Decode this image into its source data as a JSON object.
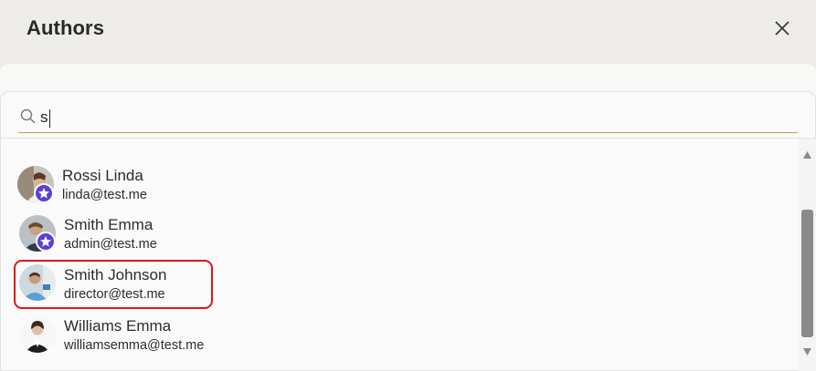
{
  "dialog": {
    "title": "Authors",
    "close_icon": "close-icon"
  },
  "search": {
    "value": "s",
    "icon": "search-icon"
  },
  "authors": [
    {
      "name": "Rossi Linda",
      "email": "linda@test.me",
      "badge": true,
      "badge_icon": "star-badge-icon"
    },
    {
      "name": "Smith Emma",
      "email": "admin@test.me",
      "badge": true,
      "badge_icon": "star-badge-icon"
    },
    {
      "name": "Smith Johnson",
      "email": "director@test.me",
      "badge": false,
      "highlighted": true
    },
    {
      "name": "Williams Emma",
      "email": "williamsemma@test.me",
      "badge": false
    }
  ],
  "colors": {
    "accent_underline": "#c99a45",
    "badge": "#5b3fd6",
    "highlight": "#e0161c"
  }
}
